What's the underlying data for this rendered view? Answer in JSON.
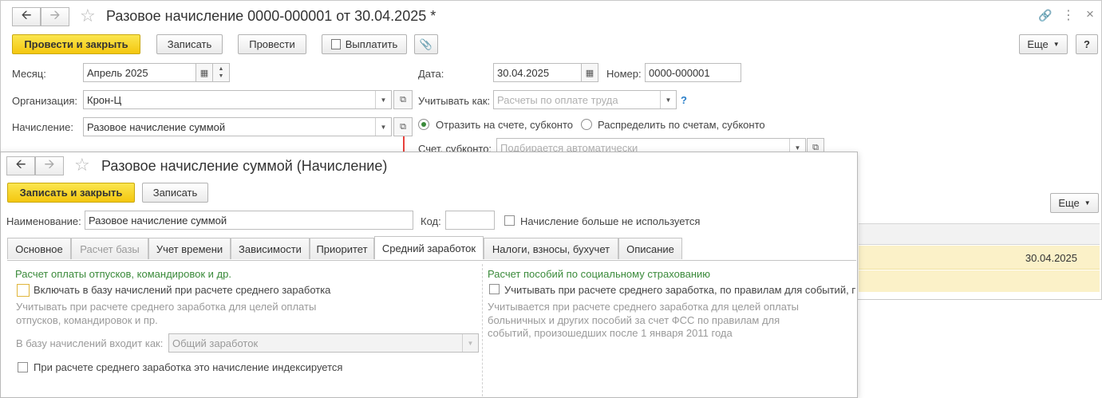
{
  "back_window": {
    "title": "Разовое начисление 0000-000001 от 30.04.2025 *",
    "toolbar": {
      "post_close": "Провести и закрыть",
      "save": "Записать",
      "post": "Провести",
      "pay": "Выплатить",
      "more": "Еще",
      "help": "?"
    },
    "month_label": "Месяц:",
    "month_value": "Апрель 2025",
    "date_label": "Дата:",
    "date_value": "30.04.2025",
    "number_label": "Номер:",
    "number_value": "0000-000001",
    "org_label": "Организация:",
    "org_value": "Крон-Ц",
    "account_as_label": "Учитывать как:",
    "account_as_placeholder": "Расчеты по оплате труда",
    "account_as_help": "?",
    "accrual_label": "Начисление:",
    "accrual_value": "Разовое начисление суммой",
    "radio_reflect": "Отразить на счете, субконто",
    "radio_distribute": "Распределить по счетам, субконто",
    "subconto_label": "Счет, субконто:",
    "subconto_placeholder": "Подбирается автоматически",
    "more2": "Еще",
    "row_date": "30.04.2025"
  },
  "front_window": {
    "title": "Разовое начисление суммой (Начисление)",
    "save_close": "Записать и закрыть",
    "save": "Записать",
    "name_label": "Наименование:",
    "name_value": "Разовое начисление суммой",
    "code_label": "Код:",
    "code_value": "",
    "not_used": "Начисление больше не используется",
    "tabs": [
      "Основное",
      "Расчет базы",
      "Учет времени",
      "Зависимости",
      "Приоритет",
      "Средний заработок",
      "Налоги, взносы, бухучет",
      "Описание"
    ],
    "left": {
      "heading": "Расчет оплаты отпусков, командировок и др.",
      "include_chk": "Включать в базу начислений при расчете среднего заработка",
      "hint1": "Учитывать при расчете среднего заработка для целей оплаты",
      "hint2": "отпусков, командировок и пр.",
      "base_label": "В базу начислений входит как:",
      "base_value": "Общий заработок",
      "indexed_chk": "При расчете среднего заработка это начисление индексируется"
    },
    "right": {
      "heading": "Расчет пособий по социальному страхованию",
      "consider_chk": "Учитывать при расчете среднего заработка, по правилам для событий, пр",
      "hint1": "Учитывается при расчете среднего заработка для целей оплаты",
      "hint2": "больничных и других пособий за счет ФСС по правилам для",
      "hint3": "событий, произошедших после 1 января 2011 года"
    }
  },
  "colors": {
    "accent_yellow": "#f4c70f",
    "heading_green": "#3a8a3a",
    "arrow_red": "#e8413c",
    "row_highlight": "#fbf1c8"
  }
}
